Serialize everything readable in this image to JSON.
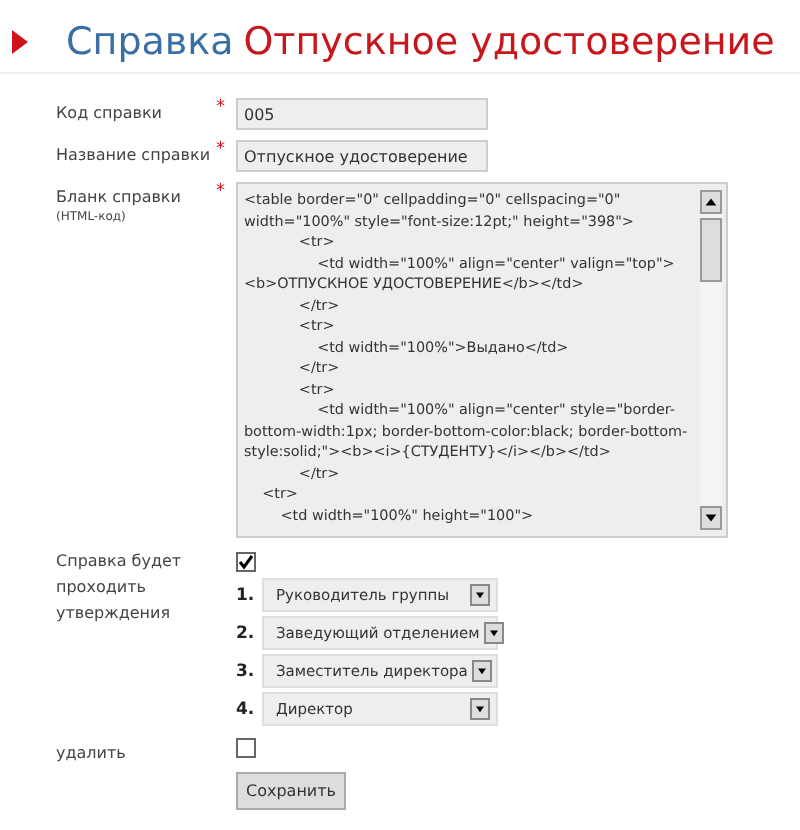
{
  "header": {
    "section": "Справка",
    "title": "Отпускное удостоверение"
  },
  "fields": [
    {
      "label": "Код справки",
      "required_mark": "*",
      "value": "005"
    },
    {
      "label": "Название справки",
      "required_mark": "*",
      "value": "Отпускное удостоверение"
    }
  ],
  "template": {
    "label": "Бланк справки",
    "sublabel": "(HTML-код)",
    "required_mark": "*",
    "value": "<table border=\"0\" cellpadding=\"0\" cellspacing=\"0\" width=\"100%\" style=\"font-size:12pt;\" height=\"398\">\n            <tr>\n                <td width=\"100%\" align=\"center\" valign=\"top\"><b>ОТПУСКНОЕ УДОСТОВЕРЕНИЕ</b></td>\n            </tr>\n            <tr>\n                <td width=\"100%\">Выдано</td>\n            </tr>\n            <tr>\n                <td width=\"100%\" align=\"center\" style=\"border-bottom-width:1px; border-bottom-color:black; border-bottom-style:solid;\"><b><i>{СТУДЕНТУ}</i></b></td>\n            </tr>\n    <tr>\n        <td width=\"100%\" height=\"100\">"
  },
  "approval": {
    "label": "Справка будет проходить утверждения",
    "checked": true,
    "steps": [
      {
        "number": "1.",
        "value": "Руководитель группы"
      },
      {
        "number": "2.",
        "value": "Заведующий отделением"
      },
      {
        "number": "3.",
        "value": "Заместитель директора"
      },
      {
        "number": "4.",
        "value": "Директор"
      }
    ]
  },
  "delete": {
    "label": "удалить",
    "checked": false
  },
  "save_button": "Сохранить"
}
